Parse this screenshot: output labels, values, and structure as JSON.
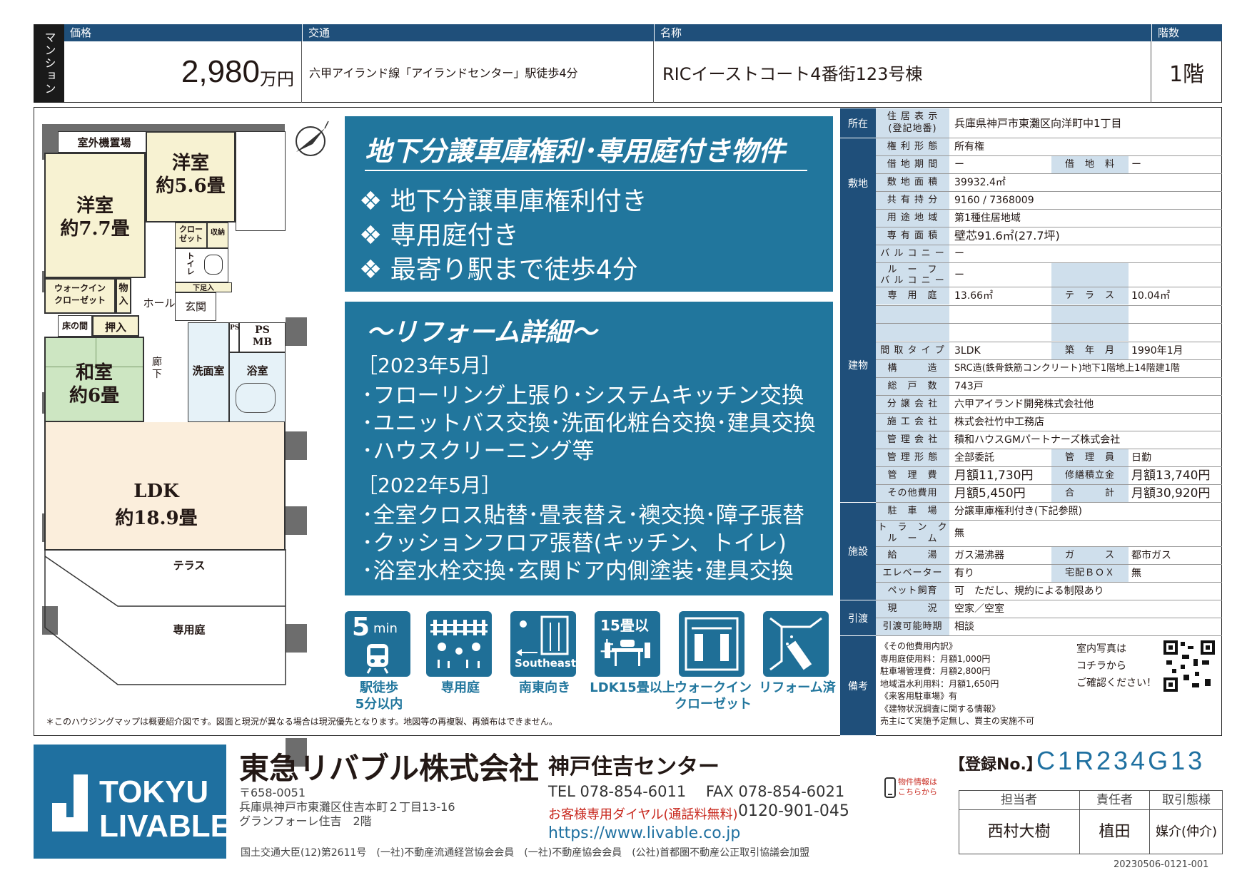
{
  "header": {
    "type_label": "マンション",
    "price_label": "価格",
    "price_value": "2,980",
    "price_unit": "万円",
    "transport_label": "交通",
    "transport_value": "六甲アイランド線「アイランドセンター」駅徒歩4分",
    "name_label": "名称",
    "name_value": "RICイーストコート4番街123号棟",
    "floor_label": "階数",
    "floor_value": "1階"
  },
  "floorplan": {
    "outdoor_unit": "室外機置場",
    "room1": "洋室",
    "room1_size": "約7.7畳",
    "room2": "洋室",
    "room2_size": "約5.6畳",
    "closet": "クロー\nゼット",
    "storage": "収納",
    "toilet": "トイレ",
    "wic": "ウォークイン\nクローゼット",
    "monoire": "物\n入",
    "hall": "ホール",
    "shoebox": "下足入",
    "entrance": "玄関",
    "tokonoma": "床の間",
    "oshiire": "押入",
    "ps": "PS",
    "psmb": "PS\nMB",
    "corridor": "廊\n下",
    "washroom": "洗面室",
    "bath": "浴室",
    "washitsu": "和室",
    "washitsu_size": "約6畳",
    "ldk": "LDK",
    "ldk_size": "約18.9畳",
    "terrace": "テラス",
    "garden": "専用庭",
    "note": "＊このハウジングマップは概要紹介図です。図面と現況が異なる場合は現況優先となります。地図等の再複製、再頒布はできません。"
  },
  "features": {
    "title": "地下分譲車庫権利･専用庭付き物件",
    "items": [
      "❖ 地下分譲車庫権利付き",
      "❖ 専用庭付き",
      "❖ 最寄り駅まで徒歩4分"
    ]
  },
  "reform": {
    "title": "～リフォーム詳細～",
    "date1": "［2023年5月］",
    "lines1": [
      "･フローリング上張り･システムキッチン交換",
      "･ユニットバス交換･洗面化粧台交換･建具交換",
      "･ハウスクリーニング等"
    ],
    "date2": "［2022年5月］",
    "lines2": [
      "･全室クロス貼替･畳表替え･襖交換･障子張替",
      "･クッションフロア張替(キッチン、トイレ)",
      "･浴室水栓交換･玄関ドア内側塗装･建具交換"
    ]
  },
  "icons": [
    {
      "name": "walk",
      "top": "5",
      "unit": "min",
      "caption": "駅徒歩\n5分以内"
    },
    {
      "name": "garden",
      "caption": "専用庭"
    },
    {
      "name": "southeast",
      "inner": "Southeast",
      "caption": "南東向き"
    },
    {
      "name": "ldk15",
      "top": "15畳以上",
      "caption": "LDK15畳以上"
    },
    {
      "name": "wic",
      "caption": "ウォークイン\nクローゼット"
    },
    {
      "name": "reform",
      "caption": "リフォーム済"
    }
  ],
  "spec": {
    "sections": {
      "location": "所在",
      "land": "敷地",
      "building": "建物",
      "facility": "施設",
      "handover": "引渡",
      "remarks": "備考"
    },
    "address_key": "住 居 表 示\n(登記地番)",
    "address_val": "兵庫県神戸市東灘区向洋町中1丁目",
    "rows": {
      "right_form": [
        "権 利 形 態",
        "所有権"
      ],
      "lease_period": [
        "借 地 期 間",
        "ー"
      ],
      "lease_fee": [
        "借　地　料",
        "ー"
      ],
      "land_area": [
        "敷 地 面 積",
        "39932.4㎡"
      ],
      "share": [
        "共 有 持 分",
        "9160 / 7368009"
      ],
      "zoning": [
        "用 途 地 域",
        "第1種住居地域"
      ],
      "floor_area": [
        "専 有 面 積",
        "壁芯91.6㎡(27.7坪)"
      ],
      "balcony": [
        "バ ル コ ニ ー",
        "ー"
      ],
      "roof_balcony": [
        "ル　ー　フ\nバ ル コ ニ ー",
        "ー"
      ],
      "garden": [
        "専　用　庭",
        "13.66㎡"
      ],
      "terrace": [
        "テ　ラ　ス",
        "10.04㎡"
      ],
      "layout": [
        "間 取 タ イ プ",
        "3LDK"
      ],
      "built": [
        "築　年　月",
        "1990年1月"
      ],
      "structure": [
        "構　　　造",
        "SRC造(鉄骨鉄筋コンクリート)地下1階地上14階建1階"
      ],
      "units": [
        "総　戸　数",
        "743戸"
      ],
      "developer": [
        "分 譲 会 社",
        "六甲アイランド開発株式会社他"
      ],
      "builder": [
        "施 工 会 社",
        "株式会社竹中工務店"
      ],
      "manager_co": [
        "管 理 会 社",
        "積和ハウスGMパートナーズ株式会社"
      ],
      "mgmt_form": [
        "管 理 形 態",
        "全部委託"
      ],
      "manager": [
        "管　理　員",
        "日勤"
      ],
      "mgmt_fee": [
        "管　理　費",
        "月額11,730円"
      ],
      "repair_fund": [
        "修繕積立金",
        "月額13,740円"
      ],
      "other_fee": [
        "その他費用",
        "月額5,450円"
      ],
      "total": [
        "合　　　計",
        "月額30,920円"
      ],
      "parking": [
        "駐　車　場",
        "分譲車庫権利付き(下記参照)"
      ],
      "trunk": [
        "ト　ラ　ン　ク\nル　ー　ム",
        "無"
      ],
      "water_heater": [
        "給　　　湯",
        "ガス湯沸器"
      ],
      "gas": [
        "ガ　　　ス",
        "都市ガス"
      ],
      "elevator": [
        "エレベーター",
        "有り"
      ],
      "delivery_box": [
        "宅配ＢＯＸ",
        "無"
      ],
      "pets": [
        "ペット飼育",
        "可　ただし、規約による制限あり"
      ],
      "status": [
        "現　　　況",
        "空家／空室"
      ],
      "handover_time": [
        "引渡可能時期",
        "相談"
      ]
    },
    "remarks": [
      "《その他費用内訳》",
      "専用庭使用料：月額1,000円",
      "駐車場管理費：月額2,800円",
      "地域温水利用料：月額1,650円",
      "《来客用駐車場》有",
      "《建物状況調査に関する情報》",
      "売主にて実施予定無し、買主の実施不可"
    ],
    "photo_note": [
      "室内写真は",
      "コチラから",
      "ご確認ください！"
    ]
  },
  "footer": {
    "logo_line1": "TOKYU",
    "logo_line2": "LIVABLE",
    "company": "東急リバブル株式会社",
    "branch": "神戸住吉センター",
    "postal": "〒658-0051",
    "address1": "兵庫県神戸市東灘区住吉本町２丁目13-16",
    "address2": "グランフォーレ住吉　2階",
    "tel": "TEL 078-854-6011　 FAX 078-854-6021",
    "dial_label": "お客様専用ダイヤル(通話料無料)",
    "dial_number": "0120-901-045",
    "url": "https://www.livable.co.jp",
    "license": "国土交通大臣(12)第2611号　(一社)不動産流通経営協会会員　(一社)不動産協会会員　(公社)首都圏不動産公正取引協議会加盟",
    "mobile_note": "物件情報は\nこちらから",
    "reg_label": "【登録No.】",
    "reg_no": "C1R234G13",
    "staff_label": "担当者",
    "staff": "西村大樹",
    "resp_label": "責任者",
    "resp": "植田",
    "deal_label": "取引態様",
    "deal": "媒介(仲介)",
    "code": "20230506-0121-001"
  },
  "colors": {
    "navy": "#1f4f7a",
    "teal": "#21769d",
    "label_bg": "#cfdfec"
  }
}
